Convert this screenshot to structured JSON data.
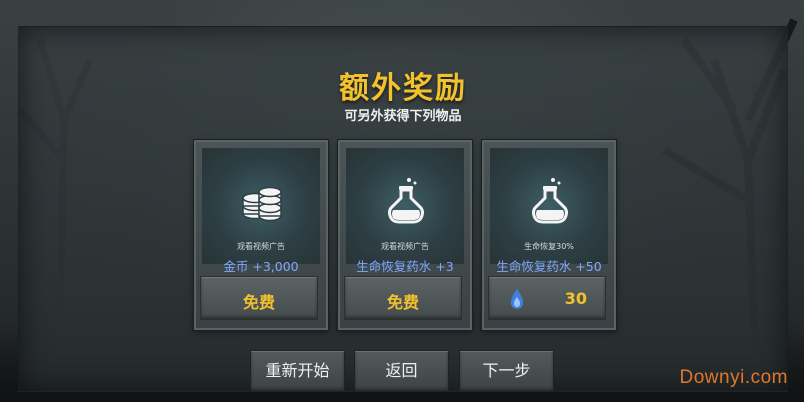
{
  "dialog": {
    "title": "额外奖励",
    "subtitle": "可另外获得下列物品"
  },
  "cards": [
    {
      "icon": "coins-icon",
      "desc": "观看视频广告",
      "reward": "金币 +3,000",
      "button_label": "免费"
    },
    {
      "icon": "potion-icon",
      "desc": "观看视频广告",
      "reward": "生命恢复药水 +3",
      "button_label": "免费"
    },
    {
      "icon": "potion-icon",
      "desc": "生命恢复30%",
      "reward": "生命恢复药水 +50",
      "cost_icon": "blue-flame-icon",
      "cost_value": "30"
    }
  ],
  "buttons": {
    "restart": "重新开始",
    "back": "返回",
    "next": "下一步"
  },
  "watermark": "Downyi.com",
  "colors": {
    "title": "#f2c12e",
    "reward_text": "#7fa8ff",
    "button_gold": "#f2c12e",
    "watermark": "#e0782c"
  }
}
